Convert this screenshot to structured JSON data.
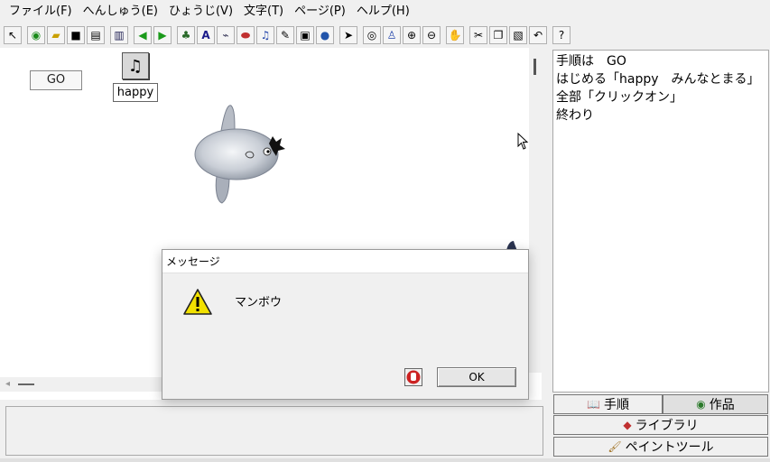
{
  "menu": [
    {
      "label": "ファイル(F)"
    },
    {
      "label": "へんしゅう(E)"
    },
    {
      "label": "ひょうじ(V)"
    },
    {
      "label": "文字(T)"
    },
    {
      "label": "ページ(P)"
    },
    {
      "label": "ヘルプ(H)"
    }
  ],
  "toolbar": {
    "help_label": "?"
  },
  "canvas": {
    "go_field": "GO",
    "sound_label": "happy"
  },
  "script": {
    "lines": [
      "手順は　GO",
      "はじめる「happy　みんなとまる」",
      "全部「クリックオン」",
      "終わり"
    ]
  },
  "tabs": {
    "steps": "手順",
    "works": "作品",
    "library": "ライブラリ",
    "paint": "ペイントツール"
  },
  "dialog": {
    "title": "メッセージ",
    "message": "マンボウ",
    "ok": "OK"
  },
  "colors": {
    "warning": "#f2e100",
    "stop": "#cc2222"
  }
}
